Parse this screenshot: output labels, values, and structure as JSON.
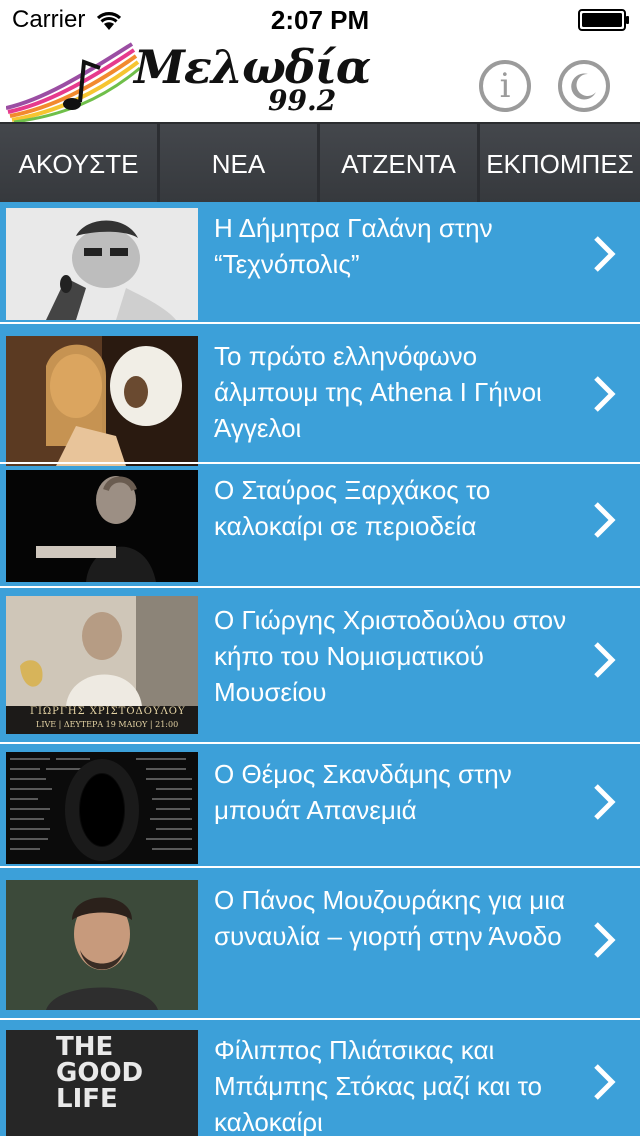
{
  "status_bar": {
    "carrier": "Carrier",
    "time": "2:07 PM",
    "wifi_icon": "wifi-icon",
    "battery_icon": "battery-icon"
  },
  "header": {
    "logo_text": "Μελωδία",
    "logo_frequency": "99.2",
    "info_label": "i",
    "info_icon": "info-icon",
    "sleep_icon": "moon-icon"
  },
  "tabs": [
    {
      "label": "ΑΚΟΥΣΤΕ"
    },
    {
      "label": "ΝΕΑ"
    },
    {
      "label": "ΑΤΖΕΝΤΑ"
    },
    {
      "label": "ΕΚΠΟΜΠΕΣ"
    }
  ],
  "news": [
    {
      "title": "Η Δήμητρα Γαλάνη στην “Τεχνόπολις”"
    },
    {
      "title": "Το πρώτο ελληνόφωνο άλμπουμ της Athena I Γήινοι Άγγελοι"
    },
    {
      "title": "Ο Σταύρος Ξαρχάκος το καλοκαίρι σε περιοδεία"
    },
    {
      "title": "Ο Γιώργης Χριστοδούλου στον κήπο του Νομισματικού Μουσείου",
      "thumb_caption": "ΓΙΩΡΓΗΣ ΧΡΙΣΤΟΔΟΥΛΟΥ",
      "thumb_subcaption": "LIVE | ΔΕΥΤΕΡΑ 19 ΜΑΙΟΥ | 21:00"
    },
    {
      "title": "Ο Θέμος Σκανδάμης στην μπουάτ Απανεμιά"
    },
    {
      "title": "Ο Πάνος Μουζουράκης για μια συναυλία – γιορτή στην Άνοδο"
    },
    {
      "title": "Φίλιππος Πλιάτσικας και Μπάμπης Στόκας μαζί και το καλοκαίρι",
      "thumb_caption": "THE GOOD LIFE"
    }
  ],
  "colors": {
    "list_background": "#3ca0d9",
    "tab_background": "#3b3e43",
    "icon_gray": "#9b9b9b"
  }
}
